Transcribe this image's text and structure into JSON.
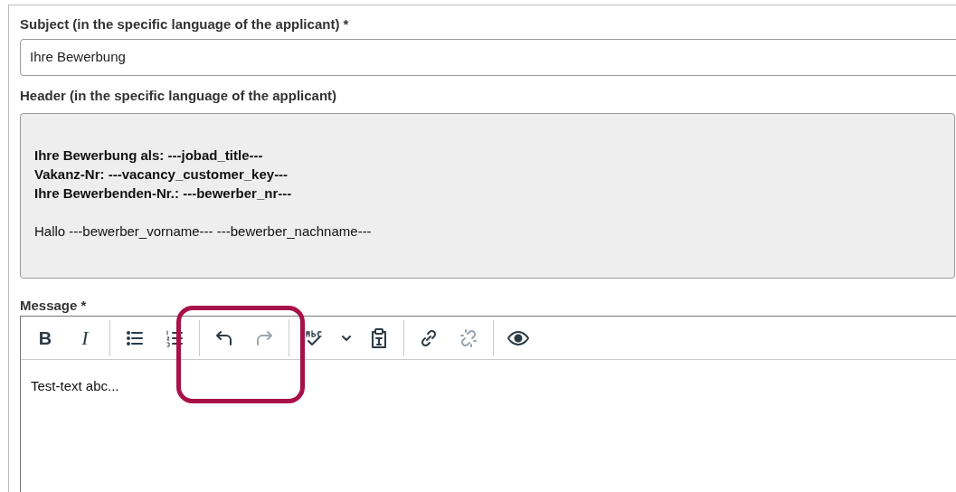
{
  "subject": {
    "label": "Subject (in the specific language of the applicant) *",
    "value": "Ihre Bewerbung"
  },
  "header": {
    "label": "Header (in the specific language of the applicant)",
    "paragraphs": [
      {
        "bold": true,
        "lines": [
          "Ihre Bewerbung als: ---jobad_title---",
          "Vakanz-Nr: ---vacancy_customer_key---",
          "Ihre Bewerbenden-Nr.: ---bewerber_nr---"
        ]
      },
      {
        "bold": false,
        "lines": [
          "Hallo ---bewerber_vorname--- ---bewerber_nachname---"
        ]
      }
    ]
  },
  "message": {
    "label": "Message *",
    "toolbar": [
      [
        {
          "kind": "bold",
          "label": "B",
          "disabled": false
        },
        {
          "kind": "italic",
          "label": "I",
          "disabled": false
        }
      ],
      [
        {
          "kind": "bulleted-list",
          "disabled": false
        },
        {
          "kind": "numbered-list",
          "disabled": false
        }
      ],
      [
        {
          "kind": "undo",
          "disabled": false
        },
        {
          "kind": "redo",
          "disabled": true
        }
      ],
      [
        {
          "kind": "spellcheck",
          "disabled": false
        },
        {
          "kind": "dropdown",
          "disabled": false
        },
        {
          "kind": "paste-text",
          "disabled": false
        }
      ],
      [
        {
          "kind": "link",
          "disabled": false
        },
        {
          "kind": "unlink",
          "disabled": true
        }
      ],
      [
        {
          "kind": "preview",
          "disabled": false
        }
      ]
    ],
    "value": "Test-text abc..."
  }
}
